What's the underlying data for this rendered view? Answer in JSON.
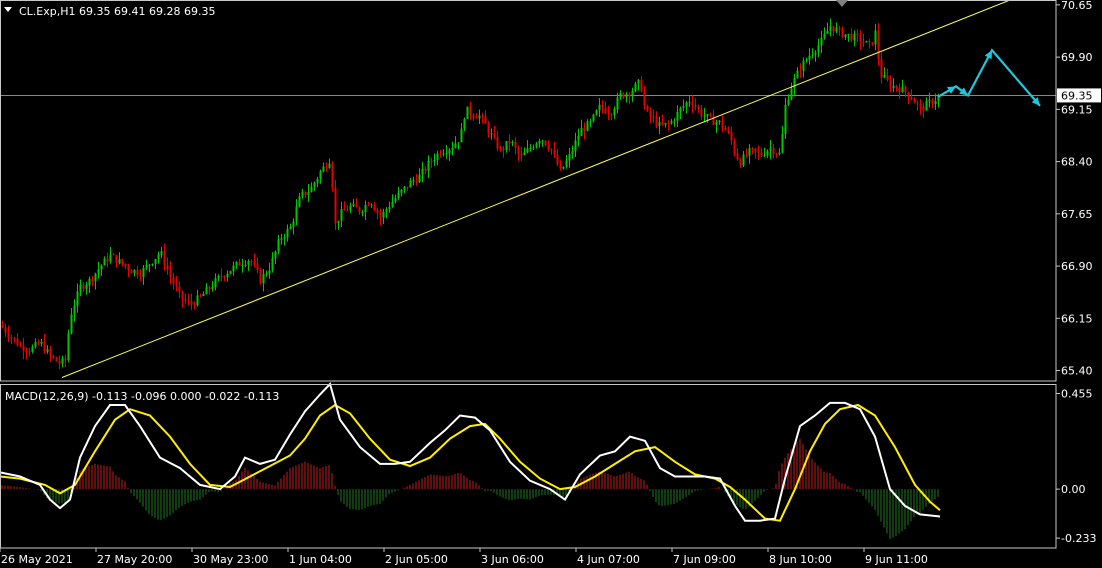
{
  "header": {
    "symbol_line": "CL.Exp,H1  69.35 69.41 69.28 69.35",
    "macd_line": "MACD(12,26,9) -0.113 -0.096 0.000 -0.022 -0.113"
  },
  "colors": {
    "background": "#000000",
    "bull": "#00c800",
    "bear": "#e60000",
    "trendline": "#ffff50",
    "arrow": "#1ec8dc",
    "macd_line": "#ffffff",
    "signal_line": "#ffee00",
    "hist_pos": "#c81e1e",
    "hist_neg": "#1e7a1e",
    "axis_text": "#ffffff",
    "frame": "#c8c8c8"
  },
  "icons": {
    "header_menu": "triangle-down-icon",
    "top_marker": "triangle-down-icon"
  },
  "chart_data": [
    {
      "type": "candlestick",
      "symbol": "CL.Exp",
      "timeframe": "H1",
      "last_price": "69.35",
      "ylim": [
        65.25,
        70.72
      ],
      "y_ticks": [
        "70.65",
        "69.90",
        "69.15",
        "68.40",
        "67.65",
        "66.90",
        "66.15",
        "65.40"
      ],
      "x_ticks": [
        "26 May 2021",
        "27 May 20:00",
        "30 May 23:00",
        "1 Jun 04:00",
        "2 Jun 05:00",
        "3 Jun 06:00",
        "4 Jun 07:00",
        "7 Jun 09:00",
        "8 Jun 10:00",
        "9 Jun 11:00"
      ],
      "close_series": [
        [
          0,
          66.05
        ],
        [
          10,
          65.9
        ],
        [
          20,
          65.75
        ],
        [
          30,
          65.7
        ],
        [
          40,
          65.8
        ],
        [
          50,
          65.6
        ],
        [
          60,
          65.5
        ],
        [
          65,
          65.55
        ],
        [
          70,
          66.2
        ],
        [
          80,
          66.6
        ],
        [
          90,
          66.7
        ],
        [
          100,
          66.9
        ],
        [
          110,
          67.05
        ],
        [
          120,
          66.95
        ],
        [
          130,
          66.85
        ],
        [
          140,
          66.8
        ],
        [
          150,
          66.95
        ],
        [
          160,
          67.1
        ],
        [
          170,
          66.75
        ],
        [
          180,
          66.45
        ],
        [
          190,
          66.35
        ],
        [
          200,
          66.45
        ],
        [
          210,
          66.6
        ],
        [
          220,
          66.75
        ],
        [
          230,
          66.85
        ],
        [
          240,
          66.95
        ],
        [
          250,
          67.0
        ],
        [
          260,
          66.7
        ],
        [
          270,
          66.9
        ],
        [
          280,
          67.3
        ],
        [
          290,
          67.45
        ],
        [
          300,
          67.9
        ],
        [
          310,
          68.0
        ],
        [
          320,
          68.25
        ],
        [
          330,
          68.45
        ],
        [
          335,
          67.5
        ],
        [
          340,
          67.65
        ],
        [
          350,
          67.75
        ],
        [
          360,
          67.7
        ],
        [
          370,
          67.85
        ],
        [
          380,
          67.6
        ],
        [
          390,
          67.8
        ],
        [
          400,
          67.95
        ],
        [
          410,
          68.1
        ],
        [
          420,
          68.2
        ],
        [
          430,
          68.4
        ],
        [
          440,
          68.55
        ],
        [
          450,
          68.6
        ],
        [
          460,
          68.75
        ],
        [
          465,
          69.15
        ],
        [
          470,
          69.1
        ],
        [
          480,
          69.05
        ],
        [
          490,
          68.8
        ],
        [
          500,
          68.55
        ],
        [
          510,
          68.7
        ],
        [
          520,
          68.45
        ],
        [
          530,
          68.6
        ],
        [
          540,
          68.75
        ],
        [
          550,
          68.6
        ],
        [
          560,
          68.25
        ],
        [
          570,
          68.5
        ],
        [
          580,
          68.85
        ],
        [
          590,
          68.95
        ],
        [
          600,
          69.2
        ],
        [
          610,
          69.1
        ],
        [
          620,
          69.35
        ],
        [
          630,
          69.4
        ],
        [
          640,
          69.55
        ],
        [
          645,
          69.1
        ],
        [
          650,
          69.05
        ],
        [
          660,
          68.9
        ],
        [
          670,
          68.95
        ],
        [
          680,
          69.15
        ],
        [
          690,
          69.3
        ],
        [
          700,
          69.1
        ],
        [
          710,
          69.0
        ],
        [
          720,
          68.95
        ],
        [
          730,
          68.75
        ],
        [
          735,
          68.5
        ],
        [
          740,
          68.4
        ],
        [
          750,
          68.55
        ],
        [
          760,
          68.5
        ],
        [
          770,
          68.6
        ],
        [
          780,
          68.5
        ],
        [
          785,
          69.2
        ],
        [
          790,
          69.45
        ],
        [
          800,
          69.75
        ],
        [
          810,
          69.95
        ],
        [
          820,
          70.1
        ],
        [
          830,
          70.35
        ],
        [
          840,
          70.25
        ],
        [
          850,
          70.2
        ],
        [
          860,
          70.15
        ],
        [
          870,
          70.05
        ],
        [
          875,
          70.25
        ],
        [
          880,
          69.65
        ],
        [
          890,
          69.5
        ],
        [
          900,
          69.45
        ],
        [
          910,
          69.35
        ],
        [
          920,
          69.15
        ],
        [
          930,
          69.25
        ],
        [
          940,
          69.35
        ]
      ]
    },
    {
      "type": "line",
      "name": "MACD(12,26,9)",
      "header_values": [
        "-0.113",
        "-0.096",
        "0.000",
        "-0.022",
        "-0.113"
      ],
      "ylim": [
        -0.28,
        0.5
      ],
      "y_ticks": [
        "0.455",
        "0.00",
        "-0.233"
      ],
      "macd": [
        [
          0,
          0.08
        ],
        [
          20,
          0.06
        ],
        [
          40,
          0.02
        ],
        [
          50,
          -0.05
        ],
        [
          60,
          -0.09
        ],
        [
          70,
          -0.05
        ],
        [
          80,
          0.15
        ],
        [
          95,
          0.3
        ],
        [
          110,
          0.4
        ],
        [
          125,
          0.4
        ],
        [
          140,
          0.3
        ],
        [
          160,
          0.15
        ],
        [
          180,
          0.1
        ],
        [
          200,
          0.02
        ],
        [
          220,
          0.0
        ],
        [
          235,
          0.06
        ],
        [
          245,
          0.15
        ],
        [
          260,
          0.12
        ],
        [
          275,
          0.14
        ],
        [
          290,
          0.26
        ],
        [
          305,
          0.37
        ],
        [
          320,
          0.45
        ],
        [
          330,
          0.5
        ],
        [
          340,
          0.33
        ],
        [
          360,
          0.2
        ],
        [
          380,
          0.12
        ],
        [
          395,
          0.12
        ],
        [
          410,
          0.13
        ],
        [
          430,
          0.22
        ],
        [
          445,
          0.28
        ],
        [
          460,
          0.35
        ],
        [
          475,
          0.34
        ],
        [
          490,
          0.28
        ],
        [
          510,
          0.13
        ],
        [
          530,
          0.04
        ],
        [
          550,
          0.0
        ],
        [
          565,
          -0.05
        ],
        [
          580,
          0.07
        ],
        [
          600,
          0.16
        ],
        [
          615,
          0.18
        ],
        [
          630,
          0.25
        ],
        [
          645,
          0.23
        ],
        [
          660,
          0.1
        ],
        [
          675,
          0.06
        ],
        [
          690,
          0.06
        ],
        [
          705,
          0.06
        ],
        [
          720,
          0.05
        ],
        [
          735,
          -0.08
        ],
        [
          745,
          -0.15
        ],
        [
          760,
          -0.15
        ],
        [
          775,
          -0.14
        ],
        [
          785,
          0.05
        ],
        [
          800,
          0.3
        ],
        [
          815,
          0.35
        ],
        [
          830,
          0.41
        ],
        [
          845,
          0.41
        ],
        [
          860,
          0.38
        ],
        [
          875,
          0.25
        ],
        [
          890,
          0.0
        ],
        [
          905,
          -0.08
        ],
        [
          920,
          -0.12
        ],
        [
          940,
          -0.13
        ]
      ],
      "signal": [
        [
          0,
          0.06
        ],
        [
          20,
          0.05
        ],
        [
          45,
          0.02
        ],
        [
          60,
          -0.02
        ],
        [
          75,
          0.02
        ],
        [
          95,
          0.18
        ],
        [
          115,
          0.33
        ],
        [
          130,
          0.38
        ],
        [
          150,
          0.35
        ],
        [
          170,
          0.25
        ],
        [
          190,
          0.12
        ],
        [
          210,
          0.02
        ],
        [
          230,
          0.01
        ],
        [
          250,
          0.06
        ],
        [
          270,
          0.11
        ],
        [
          290,
          0.16
        ],
        [
          305,
          0.24
        ],
        [
          320,
          0.35
        ],
        [
          335,
          0.4
        ],
        [
          350,
          0.36
        ],
        [
          370,
          0.24
        ],
        [
          390,
          0.14
        ],
        [
          410,
          0.11
        ],
        [
          430,
          0.15
        ],
        [
          450,
          0.24
        ],
        [
          470,
          0.3
        ],
        [
          485,
          0.31
        ],
        [
          500,
          0.24
        ],
        [
          520,
          0.13
        ],
        [
          540,
          0.05
        ],
        [
          560,
          0.0
        ],
        [
          575,
          0.01
        ],
        [
          595,
          0.06
        ],
        [
          615,
          0.12
        ],
        [
          635,
          0.18
        ],
        [
          655,
          0.2
        ],
        [
          675,
          0.13
        ],
        [
          695,
          0.07
        ],
        [
          715,
          0.05
        ],
        [
          730,
          0.01
        ],
        [
          745,
          -0.05
        ],
        [
          765,
          -0.14
        ],
        [
          780,
          -0.15
        ],
        [
          795,
          0.0
        ],
        [
          810,
          0.18
        ],
        [
          825,
          0.31
        ],
        [
          840,
          0.38
        ],
        [
          858,
          0.4
        ],
        [
          875,
          0.35
        ],
        [
          895,
          0.2
        ],
        [
          915,
          0.02
        ],
        [
          930,
          -0.06
        ],
        [
          940,
          -0.1
        ]
      ]
    }
  ]
}
